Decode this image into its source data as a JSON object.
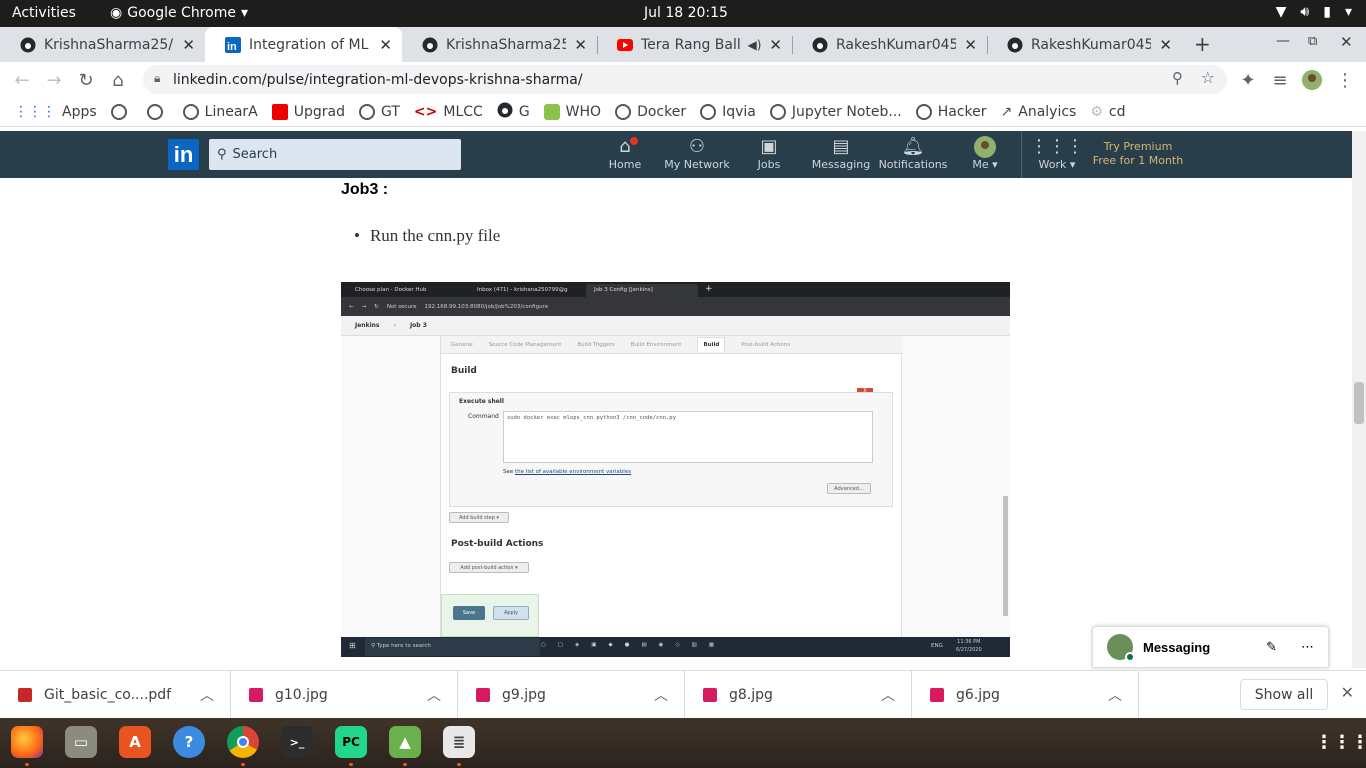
{
  "system": {
    "activities": "Activities",
    "app_name": "Google Chrome",
    "clock": "Jul 18  20:15"
  },
  "tabs": [
    {
      "title": "KrishnaSharma25/N",
      "icon": "github-icon"
    },
    {
      "title": "Integration of ML a",
      "icon": "linkedin-icon",
      "active": true
    },
    {
      "title": "KrishnaSharma25/C",
      "icon": "github-icon"
    },
    {
      "title": "Tera Rang Balle",
      "icon": "youtube-icon"
    },
    {
      "title": "RakeshKumar045/D",
      "icon": "github-icon"
    },
    {
      "title": "RakeshKumar045/N",
      "icon": "github-icon"
    }
  ],
  "omnibox": {
    "url": "linkedin.com/pulse/integration-ml-devops-krishna-sharma/"
  },
  "bookmarks": [
    {
      "label": "Apps"
    },
    {
      "label": ""
    },
    {
      "label": ""
    },
    {
      "label": "LinearA"
    },
    {
      "label": "Upgrad"
    },
    {
      "label": "GT"
    },
    {
      "label": "MLCC"
    },
    {
      "label": "G"
    },
    {
      "label": "WHO"
    },
    {
      "label": "Docker"
    },
    {
      "label": "Iqvia"
    },
    {
      "label": "Jupyter Noteb..."
    },
    {
      "label": "Hacker"
    },
    {
      "label": "Analyics"
    },
    {
      "label": "cd"
    }
  ],
  "linkedin": {
    "search_placeholder": "Search",
    "nav": [
      {
        "label": "Home"
      },
      {
        "label": "My Network"
      },
      {
        "label": "Jobs"
      },
      {
        "label": "Messaging"
      },
      {
        "label": "Notifications"
      },
      {
        "label": "Me"
      },
      {
        "label": "Work"
      }
    ],
    "premium": "Try Premium Free for 1 Month"
  },
  "article": {
    "heading": "Job3 :",
    "bullet": "Run the cnn.py file"
  },
  "embedded": {
    "tabs": [
      "Choose plan - Docker Hub",
      "Inbox (471) - krishana250799@g",
      "Job 3 Config [Jenkins]"
    ],
    "address": "192.168.99.103:8080/job/Job%203/configure",
    "not_secure": "Not secure",
    "breadcrumb": [
      "Jenkins",
      "Job 3"
    ],
    "config_tabs": [
      "General",
      "Source Code Management",
      "Build Triggers",
      "Build Environment",
      "Build",
      "Post-build Actions"
    ],
    "build_heading": "Build",
    "execute_shell": "Execute shell",
    "command_label": "Command",
    "command": "sudo docker exec mlops_cnn python3 /cnn_code/cnn.py",
    "env_link_prefix": "See",
    "env_link": "the list of available environment variables",
    "advanced": "Advanced...",
    "add_build_step": "Add build step",
    "post_build_heading": "Post-build Actions",
    "add_post_build": "Add post-build action",
    "save": "Save",
    "apply": "Apply",
    "taskbar_search": "Type here to search",
    "taskbar_time": "11:36 PM",
    "taskbar_date": "6/27/2020",
    "taskbar_lang": "ENG"
  },
  "messaging": {
    "title": "Messaging"
  },
  "downloads": [
    {
      "name": "Git_basic_co....pdf",
      "type": "pdf"
    },
    {
      "name": "g10.jpg",
      "type": "image"
    },
    {
      "name": "g9.jpg",
      "type": "image"
    },
    {
      "name": "g8.jpg",
      "type": "image"
    },
    {
      "name": "g6.jpg",
      "type": "image"
    }
  ],
  "downloads_show_all": "Show all",
  "dock": [
    "firefox-icon",
    "files-icon",
    "software-icon",
    "help-icon",
    "chrome-icon",
    "terminal-icon",
    "pycharm-icon",
    "image-viewer-icon",
    "text-editor-icon"
  ]
}
